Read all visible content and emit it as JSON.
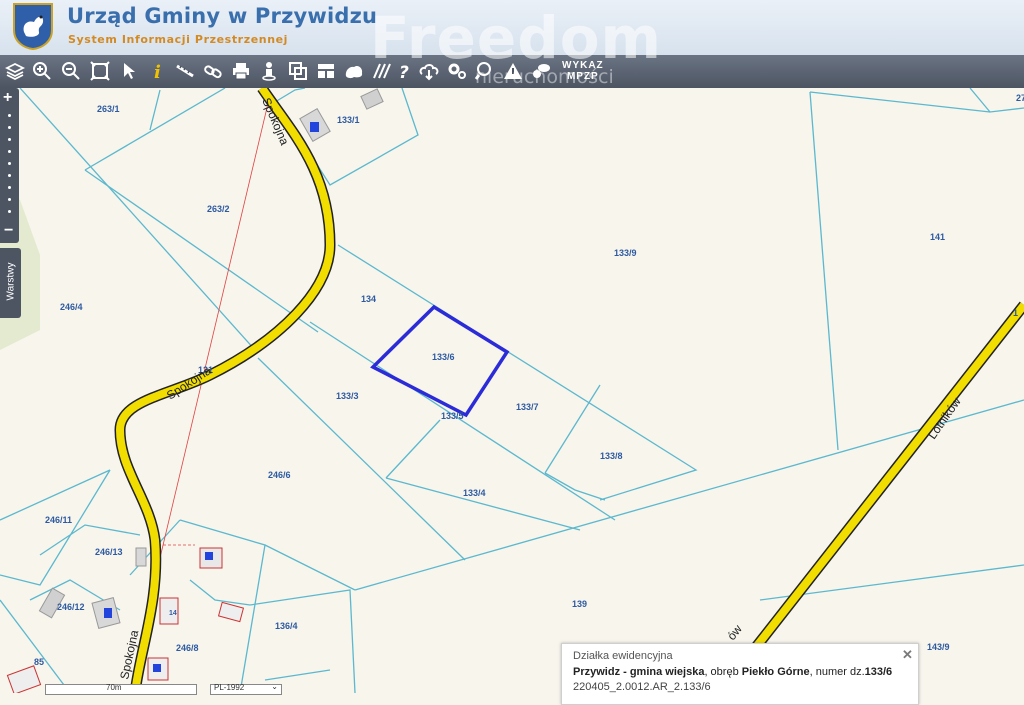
{
  "header": {
    "title": "Urząd Gminy w Przywidzu",
    "subtitle": "System Informacji Przestrzennej",
    "watermark": "Freedom",
    "watermark_sub": "nieruchomości"
  },
  "toolbar": {
    "icons": [
      "layers-icon",
      "zoom-in-icon",
      "zoom-out-icon",
      "zoom-extent-icon",
      "pointer-icon",
      "info-icon",
      "measure-icon",
      "link-icon",
      "print-icon",
      "street-view-icon",
      "copy-icon",
      "layout-icon",
      "cloud-shape-icon",
      "hatch-icon",
      "help-icon",
      "cloud-download-icon",
      "settings-icon",
      "search-zoom-icon",
      "warning-icon",
      "comment-icon"
    ],
    "wykaz_line1": "WYKAZ",
    "wykaz_line2": "MPZP"
  },
  "side": {
    "zoom_in": "+",
    "zoom_out": "−",
    "layers_tab": "Warstwy"
  },
  "map": {
    "parcels": {
      "p263_1": "263/1",
      "p133_1": "133/1",
      "p27": "27",
      "p263_2": "263/2",
      "p141": "141",
      "p133_9": "133/9",
      "p134": "134",
      "p246_4": "246/4",
      "p133_6": "133/6",
      "p121": "121",
      "p133_3": "133/3",
      "p133_7": "133/7",
      "p133_5": "133/5",
      "p133_8": "133/8",
      "p246_6": "246/6",
      "p133_4": "133/4",
      "p246_11": "246/11",
      "p246_13": "246/13",
      "p139": "139",
      "p246_12": "246/12",
      "p136_4": "136/4",
      "p143_9": "143/9",
      "p246_8": "246/8",
      "p85": "85",
      "p1": "1",
      "p14": "14"
    },
    "roads": {
      "spokojna_a": "Spokojna",
      "spokojna_b": "Spokojna",
      "spokojna_c": "Spokojna",
      "lotnikow": "Lotników",
      "partial": "ów"
    },
    "selected_parcel": "133/6"
  },
  "popup": {
    "title": "Działka ewidencyjna",
    "gmina": "Przywidz - gmina wiejska",
    "obreb_prefix": ", obręb ",
    "obreb": "Piekło Górne",
    "numer_prefix": ", numer dz.",
    "numer": "133/6",
    "identifier": "220405_2.0012.AR_2.133/6"
  },
  "scale": {
    "label": "70m"
  },
  "crs": {
    "label": "PL-1992"
  },
  "colors": {
    "map_background": "#f7f5ec",
    "parcel_line": "#5bb8cf",
    "road_fill": "#f2dd00",
    "road_edge": "#222222",
    "selection": "#2b2bd8",
    "label": "#2e5aa2"
  }
}
